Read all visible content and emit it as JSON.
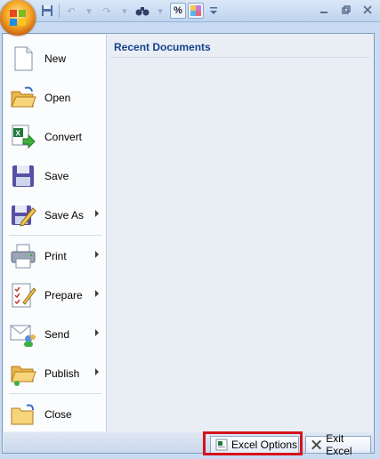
{
  "menu": {
    "items": [
      {
        "label": "New",
        "submenu": false
      },
      {
        "label": "Open",
        "submenu": false
      },
      {
        "label": "Convert",
        "submenu": false
      },
      {
        "label": "Save",
        "submenu": false
      },
      {
        "label": "Save As",
        "submenu": true
      },
      {
        "label": "Print",
        "submenu": true
      },
      {
        "label": "Prepare",
        "submenu": true
      },
      {
        "label": "Send",
        "submenu": true
      },
      {
        "label": "Publish",
        "submenu": true
      },
      {
        "label": "Close",
        "submenu": false
      }
    ],
    "recent_heading": "Recent Documents"
  },
  "footer": {
    "options_label": "Excel Options",
    "exit_label": "Exit Excel"
  },
  "qat": {
    "percent_label": "%"
  },
  "colors": {
    "highlight": "#d4141c",
    "text_blue": "#15428b"
  }
}
